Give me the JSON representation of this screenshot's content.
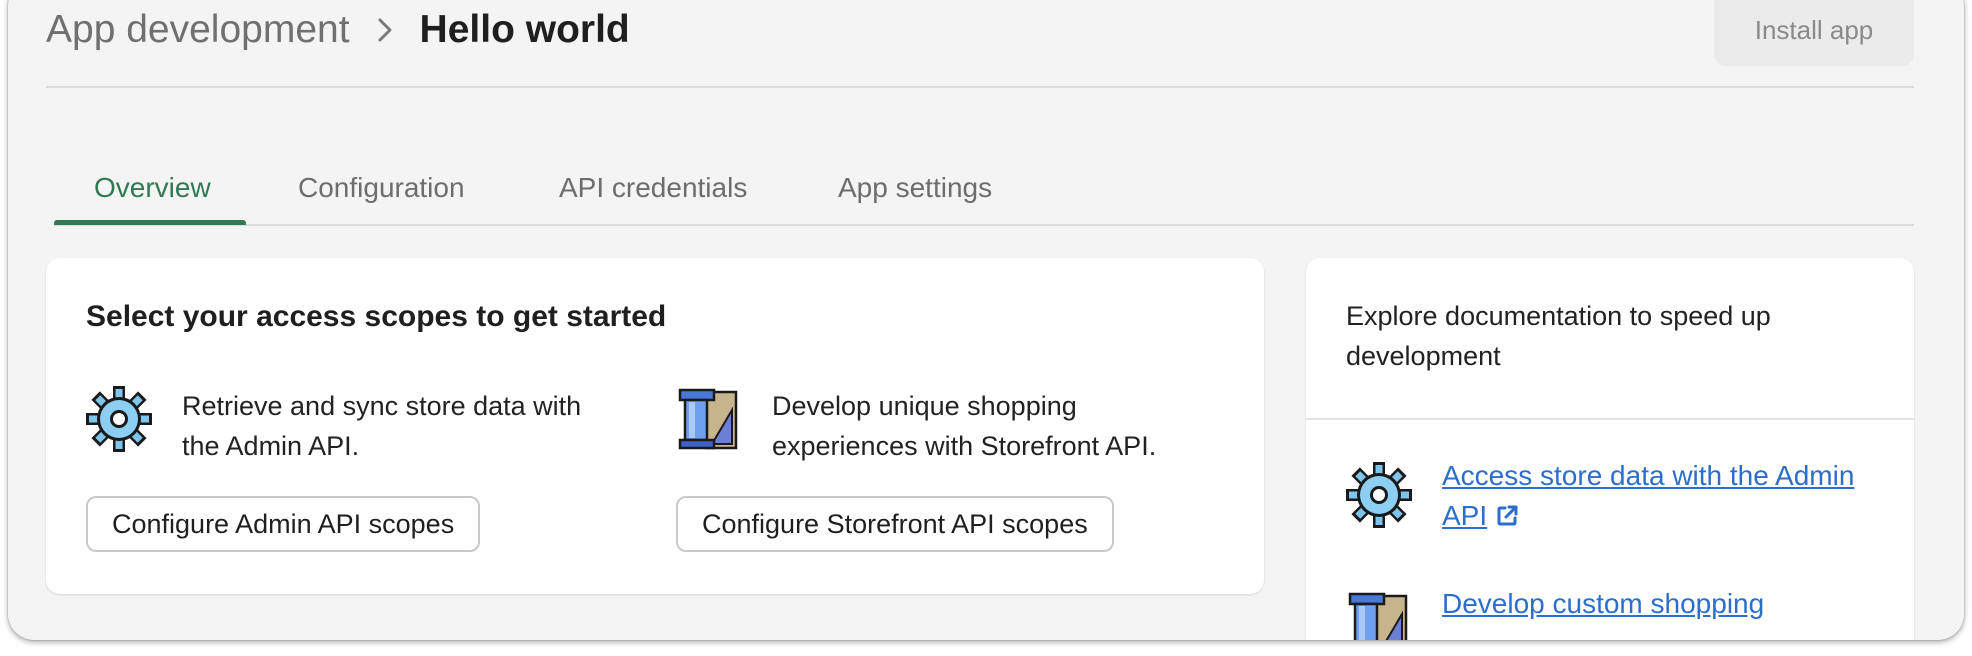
{
  "header": {
    "breadcrumb_parent": "App development",
    "title": "Hello world",
    "install_button": "Install app"
  },
  "tabs": [
    {
      "label": "Overview",
      "active": true
    },
    {
      "label": "Configuration",
      "active": false
    },
    {
      "label": "API credentials",
      "active": false
    },
    {
      "label": "App settings",
      "active": false
    }
  ],
  "main_card": {
    "title": "Select your access scopes to get started",
    "admin": {
      "icon": "gear-icon",
      "line1": "Retrieve and sync store data with",
      "line2": "the Admin API.",
      "button": "Configure Admin API scopes"
    },
    "storefront": {
      "icon": "storefront-icon",
      "line1": "Develop unique shopping",
      "line2": "experiences with Storefront API.",
      "button": "Configure Storefront API scopes"
    }
  },
  "side_card": {
    "heading": "Explore documentation to speed up development",
    "links": [
      {
        "icon": "gear-icon",
        "text": "Access store data with the Admin API",
        "external": true
      },
      {
        "icon": "storefront-icon",
        "text": "Develop custom shopping",
        "external": false
      }
    ]
  },
  "colors": {
    "accent": "#2f7a54",
    "link": "#2c6ecb",
    "background": "#f4f4f4"
  }
}
